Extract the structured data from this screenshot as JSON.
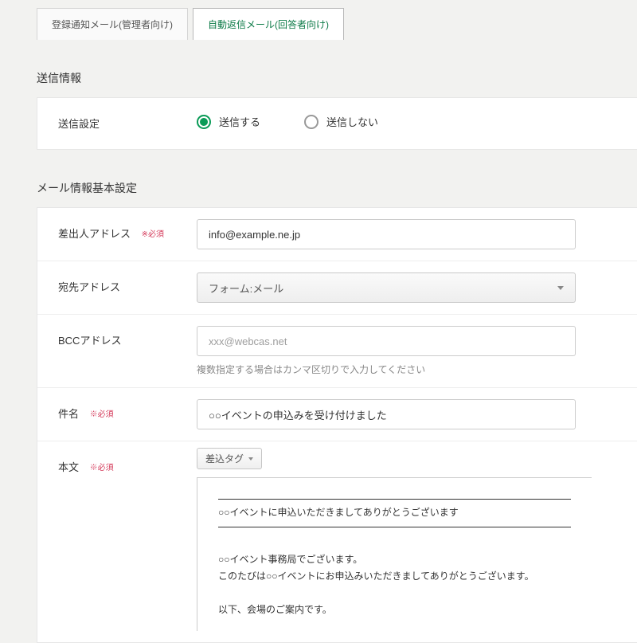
{
  "tabs": {
    "admin": "登録通知メール(管理者向け)",
    "auto": "自動返信メール(回答者向け)"
  },
  "section1": {
    "title": "送信情報",
    "setting_label": "送信設定",
    "radios": {
      "send": "送信する",
      "nosend": "送信しない"
    }
  },
  "section2": {
    "title": "メール情報基本設定",
    "required": "※必須",
    "from_label": "差出人アドレス",
    "from_value": "info@example.ne.jp",
    "to_label": "宛先アドレス",
    "to_value": "フォーム:メール",
    "bcc_label": "BCCアドレス",
    "bcc_placeholder": "xxx@webcas.net",
    "bcc_hint": "複数指定する場合はカンマ区切りで入力してください",
    "subject_label": "件名",
    "subject_value": "○○イベントの申込みを受け付けました",
    "body_label": "本文",
    "tag_button": "差込タグ",
    "body": {
      "line1": "○○イベントに申込いただきましてありがとうございます",
      "line2": "○○イベント事務局でございます。",
      "line3": "このたびは○○イベントにお申込みいただきましてありがとうございます。",
      "line4": "以下、会場のご案内です。"
    }
  }
}
